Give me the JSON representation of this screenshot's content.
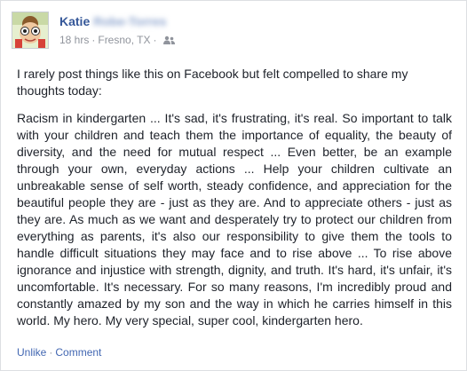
{
  "post": {
    "author_first_name": "Katie",
    "author_last_name": "Robe-Torres",
    "timestamp": "18 hrs",
    "separator": "·",
    "location": "Fresno, TX",
    "audience_icon": "friends-icon",
    "paragraphs": [
      "I rarely post things like this on Facebook but felt compelled to share my thoughts today:",
      "Racism in kindergarten ... It's sad, it's frustrating, it's real. So important to talk with your children and teach them the importance of equality, the beauty of diversity, and the need for mutual respect ... Even better, be an example through your own, everyday actions ... Help your children cultivate an unbreakable sense of self worth, steady confidence, and appreciation for the beautiful people they are - just as they are. And to appreciate others - just as they are. As much as we want and desperately try to protect our children from everything as parents, it's also our responsibility to give them the tools to handle difficult situations they may face and to rise above ... To rise above ignorance and injustice with strength, dignity, and truth. It's hard, it's unfair, it's uncomfortable. It's necessary. For so many reasons, I'm incredibly proud and constantly amazed by my son and the way in which he carries himself in this world. My hero. My very special, super cool, kindergarten hero."
    ]
  },
  "actions": {
    "unlike_label": "Unlike",
    "separator": "·",
    "comment_label": "Comment"
  },
  "colors": {
    "author_link": "#365899",
    "action_link": "#4267b2",
    "meta_text": "#90949c",
    "body_text": "#1d2129"
  }
}
